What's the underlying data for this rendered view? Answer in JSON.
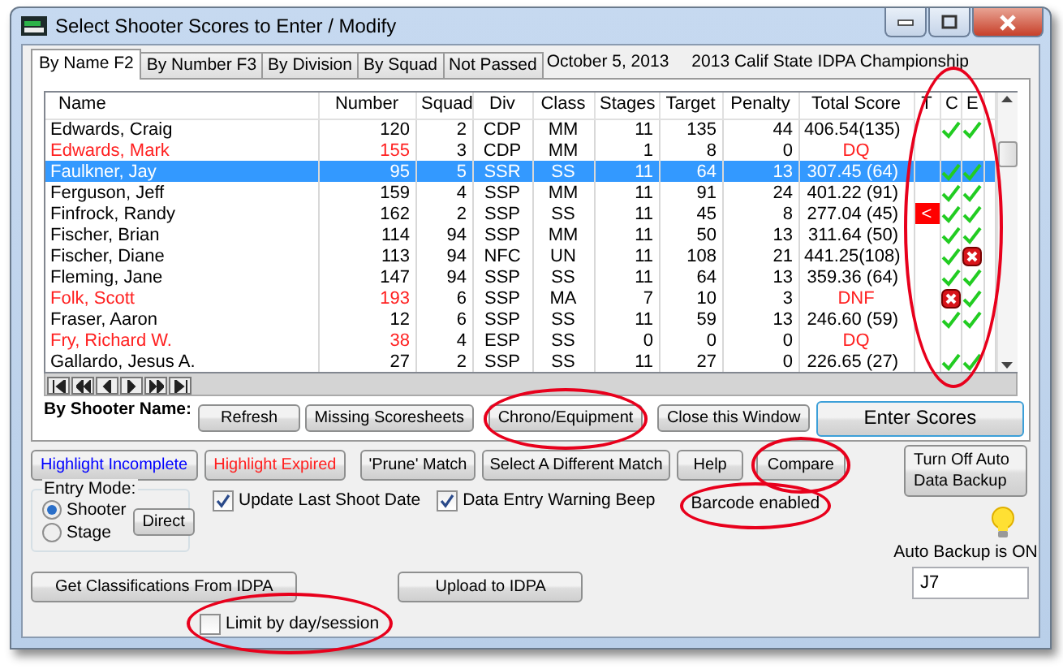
{
  "window": {
    "title": "Select Shooter Scores to Enter / Modify"
  },
  "tabs": [
    {
      "label": "By Name F2",
      "selected": true
    },
    {
      "label": "By Number F3",
      "selected": false
    },
    {
      "label": "By Division",
      "selected": false
    },
    {
      "label": "By Squad",
      "selected": false
    },
    {
      "label": "Not Passed",
      "selected": false
    }
  ],
  "match_info": {
    "date": "October  5, 2013",
    "event": "2013 Calif State IDPA Championship"
  },
  "table": {
    "columns": [
      "Name",
      "Number",
      "Squad",
      "Div",
      "Class",
      "Stages",
      "Target",
      "Penalty",
      "Total Score",
      "T",
      "C",
      "E"
    ],
    "rows": [
      {
        "name": "Edwards, Craig",
        "number": "120",
        "squad": "2",
        "div": "CDP",
        "class": "MM",
        "stages": "11",
        "target": "135",
        "penalty": "44",
        "total_score": "406.54(135)",
        "flagged": false,
        "selected": false,
        "c_passed": true,
        "e_passed": true
      },
      {
        "name": "Edwards, Mark",
        "number": "155",
        "squad": "3",
        "div": "CDP",
        "class": "MM",
        "stages": "1",
        "target": "8",
        "penalty": "0",
        "total_score": "DQ",
        "flagged": true,
        "selected": false
      },
      {
        "name": "Faulkner, Jay",
        "number": "95",
        "squad": "5",
        "div": "SSR",
        "class": "SS",
        "stages": "11",
        "target": "64",
        "penalty": "13",
        "total_score": "307.45 (64)",
        "flagged": false,
        "selected": true,
        "c_passed": true,
        "e_passed": true
      },
      {
        "name": "Ferguson, Jeff",
        "number": "159",
        "squad": "4",
        "div": "SSP",
        "class": "MM",
        "stages": "11",
        "target": "91",
        "penalty": "24",
        "total_score": "401.22 (91)",
        "flagged": false,
        "selected": false,
        "c_passed": true,
        "e_passed": true
      },
      {
        "name": "Finfrock, Randy",
        "number": "162",
        "squad": "2",
        "div": "SSP",
        "class": "SS",
        "stages": "11",
        "target": "45",
        "penalty": "8",
        "total_score": "277.04 (45)",
        "flagged": false,
        "selected": false,
        "t": "<",
        "c_passed": true,
        "e_passed": true
      },
      {
        "name": "Fischer, Brian",
        "number": "114",
        "squad": "94",
        "div": "SSP",
        "class": "MM",
        "stages": "11",
        "target": "50",
        "penalty": "13",
        "total_score": "311.64 (50)",
        "flagged": false,
        "selected": false,
        "c_passed": true,
        "e_passed": true
      },
      {
        "name": "Fischer, Diane",
        "number": "113",
        "squad": "94",
        "div": "NFC",
        "class": "UN",
        "stages": "11",
        "target": "108",
        "penalty": "21",
        "total_score": "441.25(108)",
        "flagged": false,
        "selected": false,
        "c_passed": true,
        "e_passed": false
      },
      {
        "name": "Fleming, Jane",
        "number": "147",
        "squad": "94",
        "div": "SSP",
        "class": "SS",
        "stages": "11",
        "target": "64",
        "penalty": "13",
        "total_score": "359.36 (64)",
        "flagged": false,
        "selected": false,
        "c_passed": true,
        "e_passed": true
      },
      {
        "name": "Folk, Scott",
        "number": "193",
        "squad": "6",
        "div": "SSP",
        "class": "MA",
        "stages": "7",
        "target": "10",
        "penalty": "3",
        "total_score": "DNF",
        "flagged": true,
        "selected": false,
        "c_passed": false,
        "e_passed": true
      },
      {
        "name": "Fraser, Aaron",
        "number": "12",
        "squad": "6",
        "div": "SSP",
        "class": "SS",
        "stages": "11",
        "target": "59",
        "penalty": "13",
        "total_score": "246.60 (59)",
        "flagged": false,
        "selected": false,
        "c_passed": true,
        "e_passed": true
      },
      {
        "name": "Fry, Richard W.",
        "number": "38",
        "squad": "4",
        "div": "ESP",
        "class": "SS",
        "stages": "0",
        "target": "0",
        "penalty": "0",
        "total_score": "DQ",
        "flagged": true,
        "selected": false
      },
      {
        "name": "Gallardo, Jesus A.",
        "number": "27",
        "squad": "2",
        "div": "SSP",
        "class": "SS",
        "stages": "11",
        "target": "27",
        "penalty": "0",
        "total_score": "226.65 (27)",
        "flagged": false,
        "selected": false,
        "c_passed": true,
        "e_passed": true
      }
    ]
  },
  "list_label": "By Shooter Name:",
  "list_buttons": [
    "Refresh",
    "Missing Scoresheets",
    "Chrono/Equipment",
    "Close this Window"
  ],
  "enter_button": "Enter Scores",
  "action_buttons": [
    {
      "label": "Highlight Incomplete",
      "color": "#0000ff"
    },
    {
      "label": "Highlight Expired",
      "color": "#ff2020"
    },
    {
      "label": "'Prune' Match"
    },
    {
      "label": "Select A Different  Match"
    },
    {
      "label": "Help"
    },
    {
      "label": "Compare"
    }
  ],
  "backup_button": "Turn Off Auto Data Backup",
  "entry_mode": {
    "title": "Entry Mode:",
    "options": [
      {
        "label": "Shooter",
        "selected": true
      },
      {
        "label": "Stage",
        "selected": false
      }
    ],
    "button": "Direct"
  },
  "options": [
    {
      "label": "Update Last Shoot Date",
      "checked": true
    },
    {
      "label": "Data Entry Warning Beep",
      "checked": true
    }
  ],
  "barcode_status": "Barcode enabled",
  "auto_backup": {
    "on": true,
    "status": "Auto Backup is ON",
    "value": "J7"
  },
  "bottom_buttons": [
    "Get Classifications From IDPA",
    "Upload to IDPA"
  ],
  "limit_option": {
    "label": "Limit by day/session",
    "checked": false
  }
}
